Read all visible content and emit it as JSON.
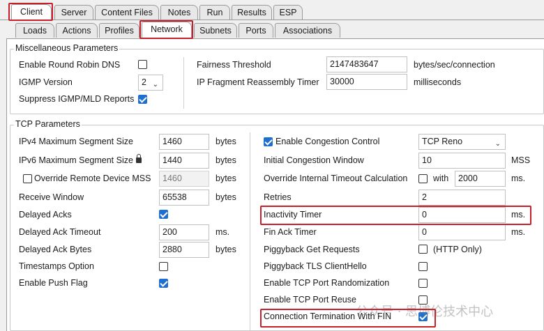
{
  "tabs_top": [
    "Client",
    "Server",
    "Content Files",
    "Notes",
    "Run",
    "Results",
    "ESP"
  ],
  "tabs_sub": [
    "Loads",
    "Actions",
    "Profiles",
    "Network",
    "Subnets",
    "Ports",
    "Associations"
  ],
  "misc": {
    "title": "Miscellaneous Parameters",
    "round_robin_label": "Enable Round Robin DNS",
    "round_robin_checked": false,
    "igmp_label": "IGMP Version",
    "igmp_value": "2",
    "suppress_label": "Suppress IGMP/MLD Reports",
    "suppress_checked": true,
    "fairness_label": "Fairness Threshold",
    "fairness_value": "2147483647",
    "fairness_unit": "bytes/sec/connection",
    "ipfrag_label": "IP Fragment Reassembly Timer",
    "ipfrag_value": "30000",
    "ipfrag_unit": "milliseconds"
  },
  "tcp": {
    "title": "TCP Parameters",
    "ipv4_mss_label": "IPv4 Maximum Segment Size",
    "ipv4_mss_value": "1460",
    "ipv6_mss_label": "IPv6 Maximum Segment Size",
    "ipv6_mss_value": "1440",
    "override_mss_label": "Override Remote Device MSS",
    "override_mss_checked": false,
    "override_mss_value": "1460",
    "recv_window_label": "Receive Window",
    "recv_window_value": "65538",
    "delayed_acks_label": "Delayed Acks",
    "delayed_acks_checked": true,
    "delayed_ack_timeout_label": "Delayed Ack Timeout",
    "delayed_ack_timeout_value": "200",
    "delayed_ack_bytes_label": "Delayed Ack Bytes",
    "delayed_ack_bytes_value": "2880",
    "timestamps_label": "Timestamps Option",
    "timestamps_checked": false,
    "push_flag_label": "Enable Push Flag",
    "push_flag_checked": true,
    "unit_bytes": "bytes",
    "unit_ms": "ms.",
    "congestion_label": "Enable Congestion Control",
    "congestion_checked": true,
    "congestion_value": "TCP Reno",
    "initial_window_label": "Initial Congestion Window",
    "initial_window_value": "10",
    "initial_window_unit": "MSS",
    "override_timeout_label": "Override Internal Timeout Calculation",
    "override_timeout_checked": false,
    "with_label": "with",
    "override_timeout_value": "2000",
    "retries_label": "Retries",
    "retries_value": "2",
    "inactivity_label": "Inactivity Timer",
    "inactivity_value": "0",
    "fin_ack_label": "Fin Ack Timer",
    "fin_ack_value": "0",
    "piggyback_get_label": "Piggyback Get Requests",
    "piggyback_get_checked": false,
    "http_only_label": "(HTTP Only)",
    "piggyback_tls_label": "Piggyback TLS ClientHello",
    "piggyback_tls_checked": false,
    "port_random_label": "Enable TCP Port Randomization",
    "port_random_checked": false,
    "port_reuse_label": "Enable TCP Port Reuse",
    "port_reuse_checked": false,
    "conn_term_label": "Connection Termination With FIN",
    "conn_term_checked": true
  },
  "watermark": "公众号 · 思博伦技术中心",
  "colors": {
    "highlight": "#c8202a",
    "check": "#1f6fd0"
  }
}
